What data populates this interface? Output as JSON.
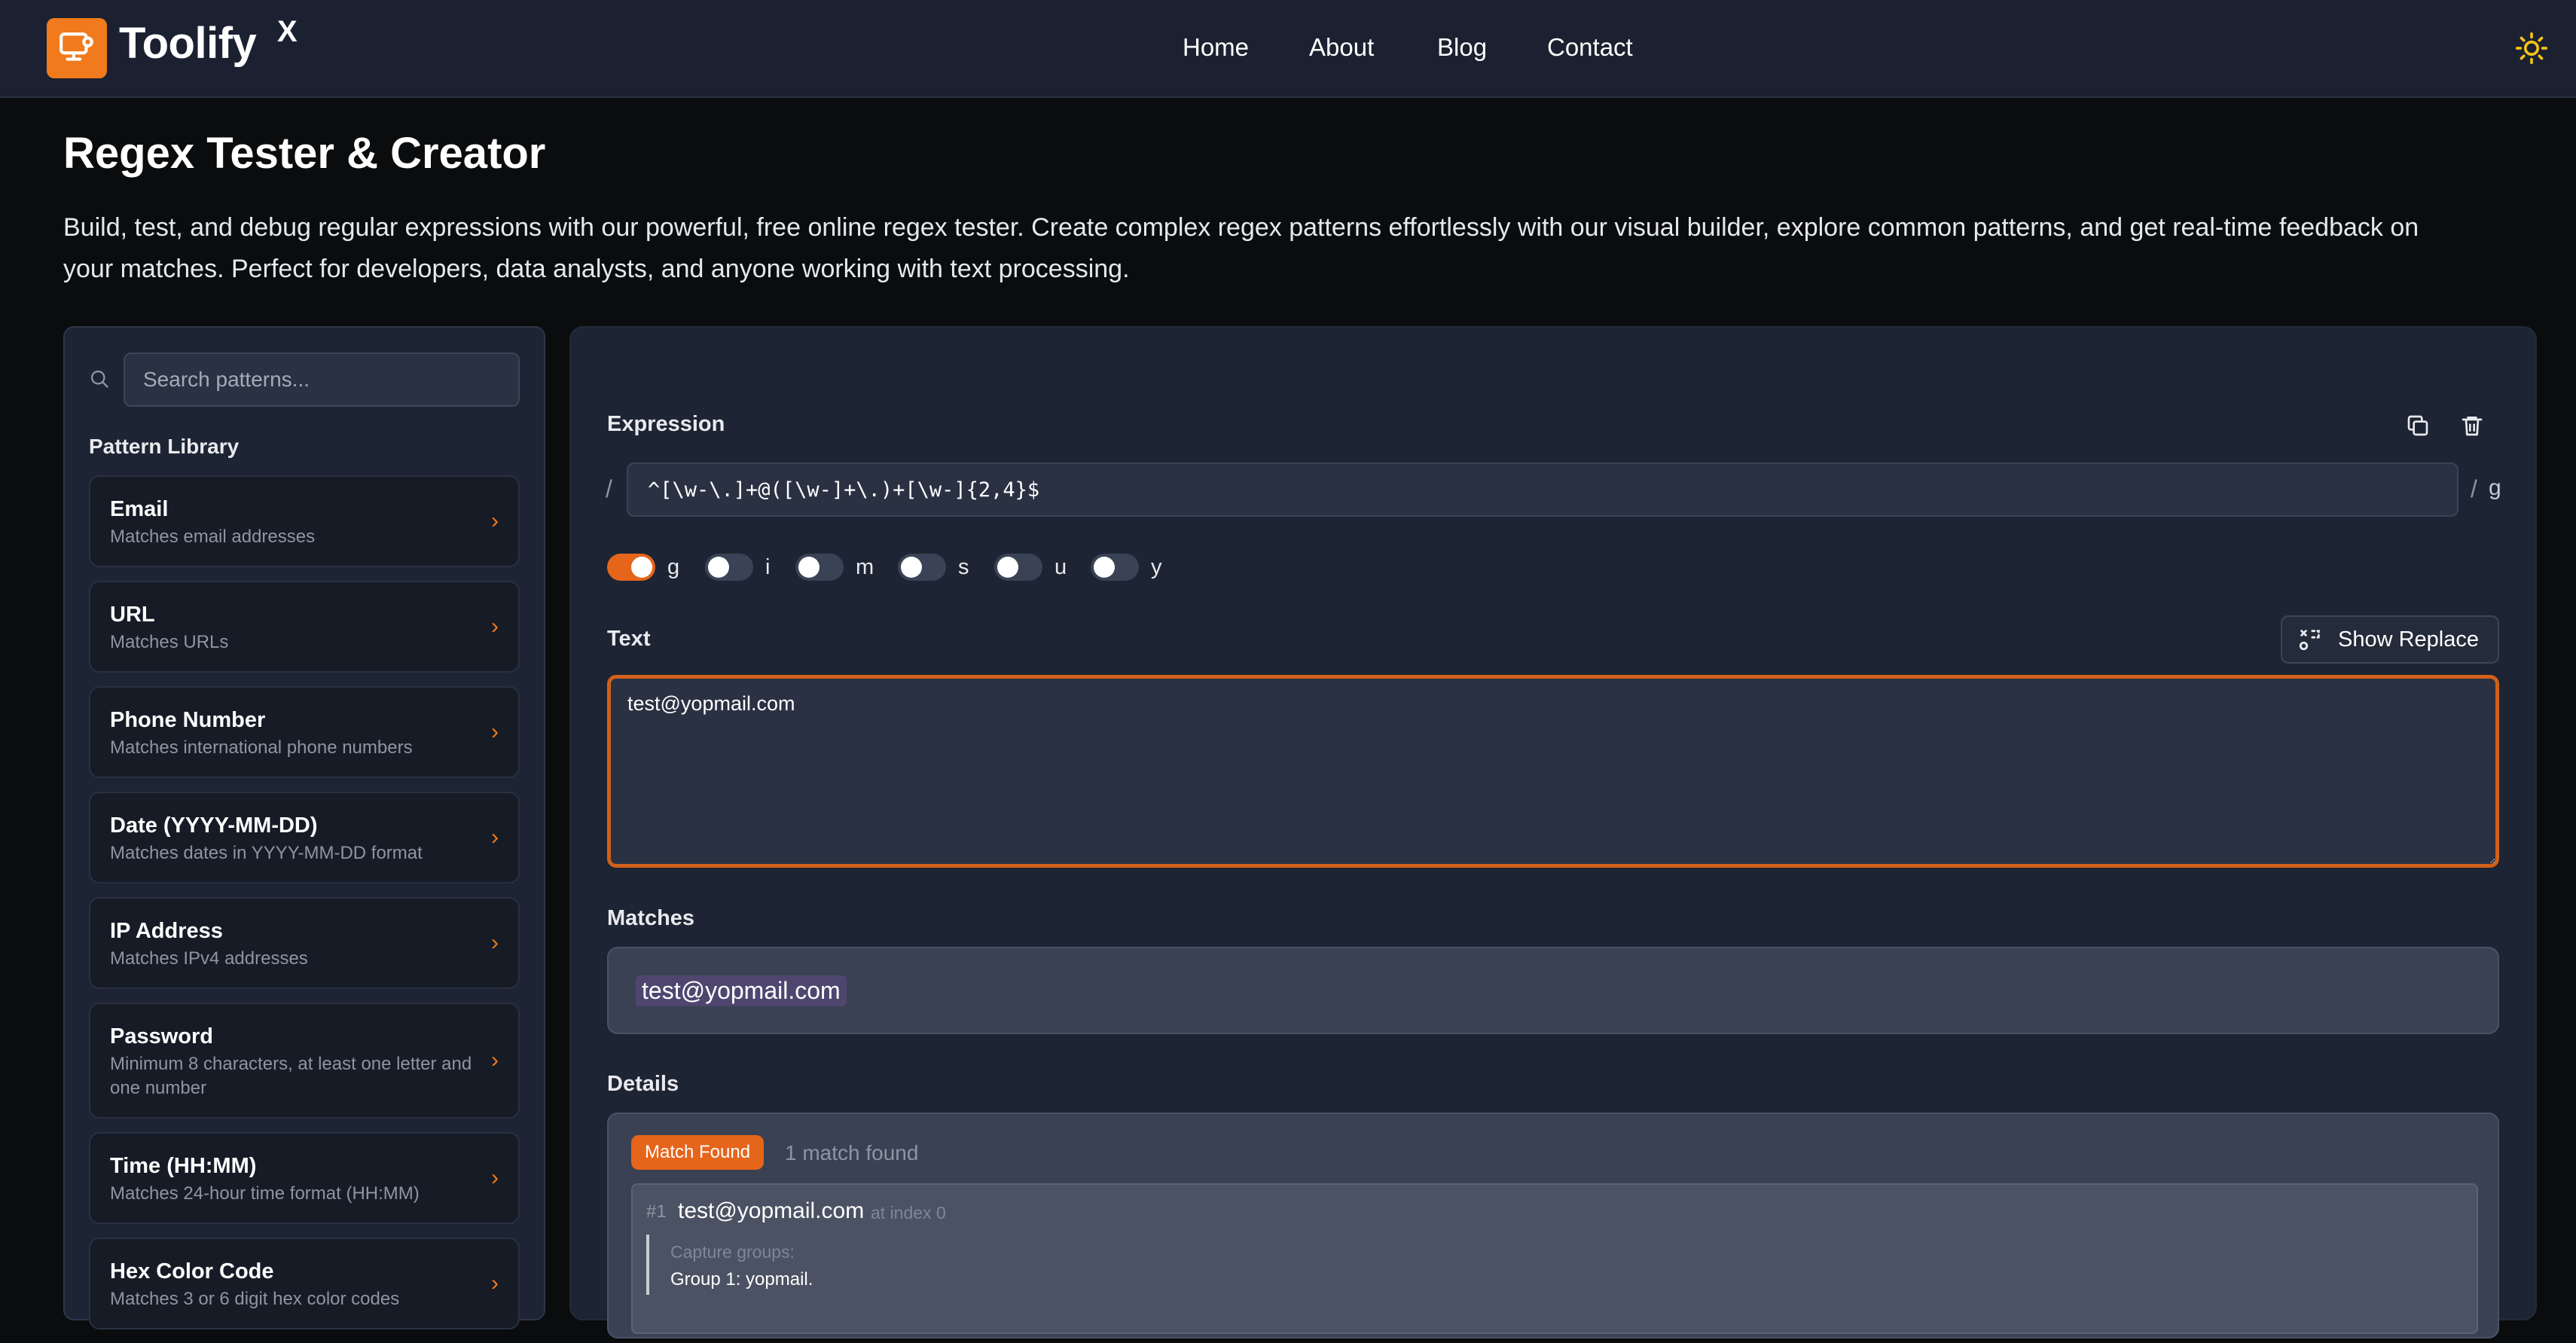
{
  "header": {
    "brand": "Toolify",
    "brand_sup": "X",
    "nav": [
      "Home",
      "About",
      "Blog",
      "Contact"
    ],
    "theme_icon": "sun-icon"
  },
  "page": {
    "title": "Regex Tester & Creator",
    "intro": "Build, test, and debug regular expressions with our powerful, free online regex tester. Create complex regex patterns effortlessly with our visual builder, explore common patterns, and get real-time feedback on your matches. Perfect for developers, data analysts, and anyone working with text processing."
  },
  "sidebar": {
    "search_placeholder": "Search patterns...",
    "library_title": "Pattern Library",
    "patterns": [
      {
        "name": "Email",
        "desc": "Matches email addresses"
      },
      {
        "name": "URL",
        "desc": "Matches URLs"
      },
      {
        "name": "Phone Number",
        "desc": "Matches international phone numbers"
      },
      {
        "name": "Date (YYYY-MM-DD)",
        "desc": "Matches dates in YYYY-MM-DD format"
      },
      {
        "name": "IP Address",
        "desc": "Matches IPv4 addresses"
      },
      {
        "name": "Password",
        "desc": "Minimum 8 characters, at least one letter and one number"
      },
      {
        "name": "Time (HH:MM)",
        "desc": "Matches 24-hour time format (HH:MM)"
      },
      {
        "name": "Hex Color Code",
        "desc": "Matches 3 or 6 digit hex color codes"
      }
    ]
  },
  "editor": {
    "expression_label": "Expression",
    "slash_open": "/",
    "slash_close": "/",
    "flags_suffix": "g",
    "expression": "^[\\w-\\.]+@([\\w-]+\\.)+[\\w-]{2,4}$",
    "flags": [
      {
        "label": "g",
        "on": true
      },
      {
        "label": "i",
        "on": false
      },
      {
        "label": "m",
        "on": false
      },
      {
        "label": "s",
        "on": false
      },
      {
        "label": "u",
        "on": false
      },
      {
        "label": "y",
        "on": false
      }
    ],
    "text_label": "Text",
    "show_replace_label": "Show Replace",
    "text_value": "test@yopmail.com",
    "matches_label": "Matches",
    "match_highlight": "test@yopmail.com",
    "details_label": "Details",
    "badge": "Match Found",
    "match_count": "1 match found",
    "match": {
      "num": "#1",
      "value": "test@yopmail.com",
      "index": "at index 0",
      "groups_title": "Capture groups:",
      "group_1": "Group 1: yopmail."
    }
  },
  "colors": {
    "accent": "#f07a1c",
    "panel": "#1d2433",
    "header": "#1b2130",
    "background": "#0b0c0e"
  }
}
